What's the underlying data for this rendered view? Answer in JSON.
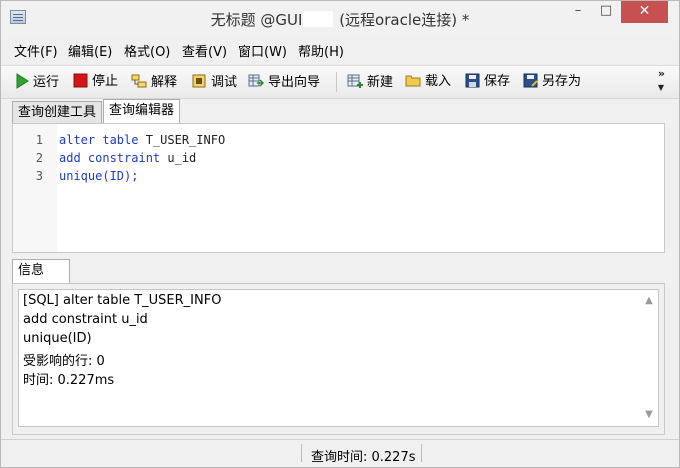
{
  "window": {
    "title_prefix": "无标题 @GUI",
    "title_suffix": "(远程oracle连接) *",
    "min_glyph": "–",
    "max_glyph": "□",
    "close_glyph": "✕"
  },
  "menu": {
    "items": [
      "文件(F)",
      "编辑(E)",
      "格式(O)",
      "查看(V)",
      "窗口(W)",
      "帮助(H)"
    ]
  },
  "toolbar": {
    "run": "运行",
    "stop": "停止",
    "explain": "解释",
    "debug": "调试",
    "export_wizard": "导出向导",
    "new": "新建",
    "load": "载入",
    "save": "保存",
    "save_as": "另存为",
    "overflow": "»"
  },
  "tabs": {
    "query_builder": "查询创建工具",
    "query_editor": "查询编辑器"
  },
  "editor": {
    "lines": [
      {
        "no": "1",
        "kw1": "alter table",
        "rest": " T_USER_INFO"
      },
      {
        "no": "2",
        "kw1": "add constraint",
        "rest": " u_id"
      },
      {
        "no": "3",
        "kw1": "unique",
        "rest": "(ID);"
      }
    ]
  },
  "info": {
    "tab_label": "信息",
    "lines": [
      "[SQL] alter table T_USER_INFO",
      "add constraint u_id",
      "unique(ID)",
      "受影响的行: 0",
      "时间: 0.227ms"
    ]
  },
  "status": {
    "query_time": "查询时间: 0.227s"
  },
  "colors": {
    "keyword": "#1e3cc8",
    "close_button": "#c75050"
  }
}
